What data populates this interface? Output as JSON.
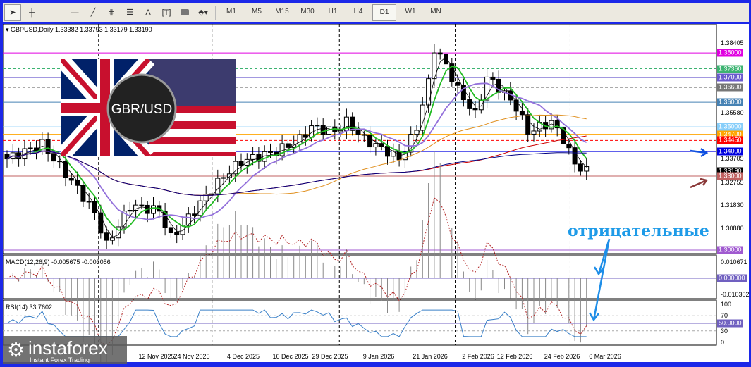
{
  "toolbar": {
    "tools": [
      "cursor",
      "crosshair",
      "vertical-line",
      "horizontal-line",
      "trend-line",
      "fibonacci-fan",
      "fibonacci-retracement",
      "text",
      "text-label",
      "rectangle",
      "shapes-menu"
    ],
    "text_tool_label": "A",
    "timeframes": [
      "M1",
      "M5",
      "M15",
      "M30",
      "H1",
      "H4",
      "D1",
      "W1",
      "MN"
    ],
    "selected_timeframe": "D1"
  },
  "chart": {
    "symbol_header": "GBPUSD,Daily  1.33382 1.33793 1.33179 1.33190",
    "flag_label": "GBR/USD",
    "annotation": "отрицательные",
    "price_ticks": [
      "1.38405",
      "1.35580",
      "1.33705",
      "1.32755",
      "1.31830",
      "1.30880"
    ],
    "price_levels": [
      {
        "label": "1.38000",
        "value": 1.38,
        "color": "#e000e0"
      },
      {
        "label": "1.37360",
        "value": 1.3736,
        "color": "#3cb371"
      },
      {
        "label": "1.37000",
        "value": 1.37,
        "color": "#6a5acd"
      },
      {
        "label": "1.36600",
        "value": 1.366,
        "color": "#777777"
      },
      {
        "label": "1.36000",
        "value": 1.36,
        "color": "#4682b4"
      },
      {
        "label": "1.35000",
        "value": 1.35,
        "color": "#87cefa"
      },
      {
        "label": "1.34700",
        "value": 1.347,
        "color": "#ffa500"
      },
      {
        "label": "1.34450",
        "value": 1.3445,
        "color": "#ff0000"
      },
      {
        "label": "1.34000",
        "value": 1.34,
        "color": "#0000e0"
      },
      {
        "label": "1.33190",
        "value": 1.3319,
        "color": "#000000"
      },
      {
        "label": "1.33000",
        "value": 1.33,
        "color": "#c06060"
      },
      {
        "label": "1.30000",
        "value": 1.3,
        "color": "#a05ad0"
      }
    ],
    "price_path": [
      [
        0,
        1.337
      ],
      [
        6,
        1.343
      ],
      [
        12,
        1.325
      ],
      [
        15,
        1.315
      ],
      [
        17,
        1.302
      ],
      [
        21,
        1.318
      ],
      [
        26,
        1.316
      ],
      [
        28,
        1.305
      ],
      [
        31,
        1.313
      ],
      [
        34,
        1.322
      ],
      [
        37,
        1.33
      ],
      [
        40,
        1.336
      ],
      [
        46,
        1.34
      ],
      [
        50,
        1.345
      ],
      [
        52,
        1.35
      ],
      [
        56,
        1.348
      ],
      [
        58,
        1.352
      ],
      [
        61,
        1.345
      ],
      [
        65,
        1.34
      ],
      [
        67,
        1.337
      ],
      [
        69,
        1.345
      ],
      [
        70,
        1.35
      ],
      [
        72,
        1.368
      ],
      [
        73,
        1.382
      ],
      [
        75,
        1.375
      ],
      [
        77,
        1.365
      ],
      [
        80,
        1.355
      ],
      [
        82,
        1.37
      ],
      [
        84,
        1.366
      ],
      [
        87,
        1.358
      ],
      [
        89,
        1.348
      ],
      [
        93,
        1.352
      ],
      [
        95,
        1.345
      ],
      [
        97,
        1.335
      ],
      [
        99,
        1.3319
      ]
    ]
  },
  "macd": {
    "label": "MACD(12,26,9) -0.005675 -0.003056",
    "ticks": [
      "0.010671",
      "0.000000",
      "-0.010302"
    ]
  },
  "rsi": {
    "label": "RSI(14) 33.7602",
    "ticks": [
      "100",
      "70",
      "50.0000",
      "30",
      "0"
    ]
  },
  "dates": [
    "12 Nov 2025",
    "24 Nov 2025",
    "4 Dec 2025",
    "16 Dec 2025",
    "29 Dec 2025",
    "9 Jan 2026",
    "21 Jan 2026",
    "2 Feb 2026",
    "12 Feb 2026",
    "24 Feb 2026",
    "6 Mar 2026"
  ],
  "logo": {
    "name": "instaforex",
    "tagline": "Instant Forex Trading"
  }
}
